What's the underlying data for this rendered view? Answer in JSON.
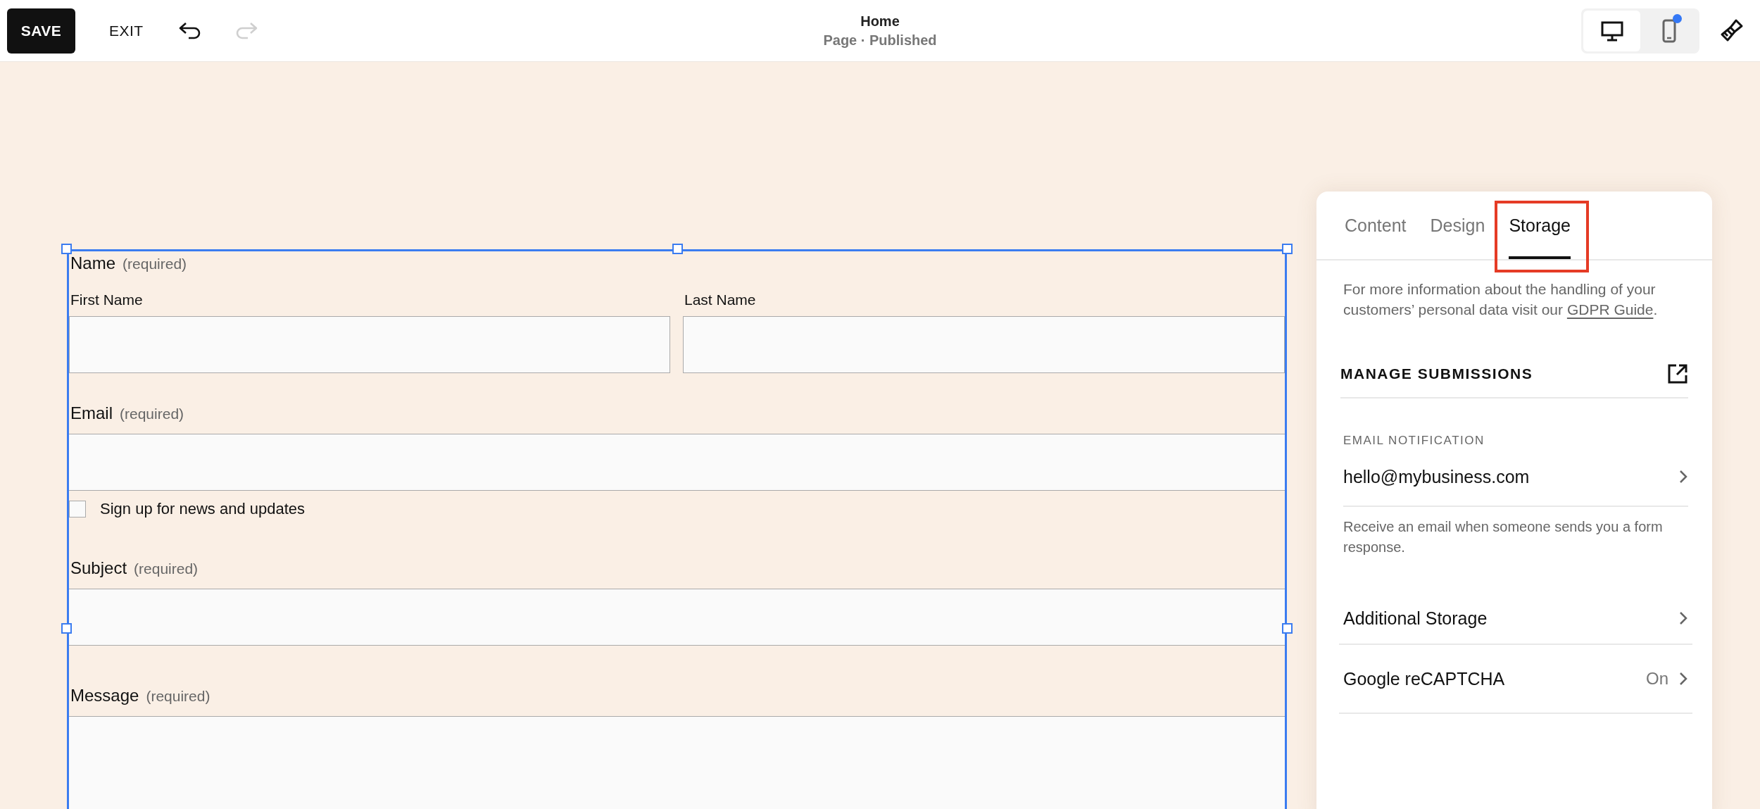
{
  "toolbar": {
    "save": "SAVE",
    "exit": "EXIT",
    "undo": {
      "disabled": false
    },
    "redo": {
      "disabled": true
    },
    "title": "Home",
    "subtitle": "Page · Published",
    "views": [
      {
        "kind": "desktop",
        "selected": true,
        "notification": false
      },
      {
        "kind": "mobile",
        "selected": false,
        "notification": true
      }
    ]
  },
  "form": {
    "selected": true,
    "fields": [
      {
        "kind": "name",
        "label": "Name",
        "note": "(required)",
        "parts": [
          {
            "label": "First Name"
          },
          {
            "label": "Last Name"
          }
        ]
      },
      {
        "kind": "text",
        "label": "Email",
        "note": "(required)"
      },
      {
        "kind": "checkbox",
        "label": "Sign up for news and updates",
        "checked": false
      },
      {
        "kind": "text",
        "label": "Subject",
        "note": "(required)"
      },
      {
        "kind": "textarea",
        "label": "Message",
        "note": "(required)"
      }
    ]
  },
  "panel": {
    "tabs": [
      {
        "label": "Content",
        "selected": false,
        "highlighted": false
      },
      {
        "label": "Design",
        "selected": false,
        "highlighted": false
      },
      {
        "label": "Storage",
        "selected": true,
        "highlighted": true
      }
    ],
    "info": {
      "text": "For more information about the handling of your customers’ personal data visit our ",
      "link": "GDPR Guide",
      "after": "."
    },
    "manage_submissions": "MANAGE SUBMISSIONS",
    "email_notification": {
      "label": "EMAIL NOTIFICATION",
      "value": "hello@mybusiness.com",
      "help": "Receive an email when someone sends you a form response."
    },
    "rows": [
      {
        "label": "Additional Storage"
      },
      {
        "label": "Google reCAPTCHA",
        "value": "On"
      }
    ]
  }
}
